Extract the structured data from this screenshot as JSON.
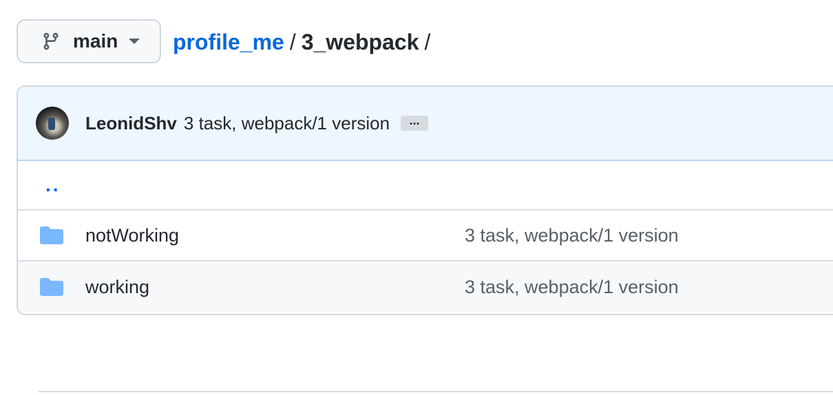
{
  "branch": {
    "name": "main",
    "icon": "git-branch-icon"
  },
  "breadcrumb": {
    "repo": "profile_me",
    "separator": "/",
    "current": "3_webpack",
    "trailing": "/"
  },
  "latest_commit": {
    "author": "LeonidShv",
    "message": "3 task, webpack/1 version",
    "more": "..."
  },
  "files": {
    "parent_link": "..",
    "items": [
      {
        "name": "notWorking",
        "type": "folder",
        "icon": "folder-icon",
        "commit": "3 task, webpack/1 version"
      },
      {
        "name": "working",
        "type": "folder",
        "icon": "folder-icon",
        "commit": "3 task, webpack/1 version"
      }
    ]
  },
  "colors": {
    "link": "#0969da",
    "folder": "#79b8ff",
    "commit_bar_bg": "#eef6ff"
  }
}
